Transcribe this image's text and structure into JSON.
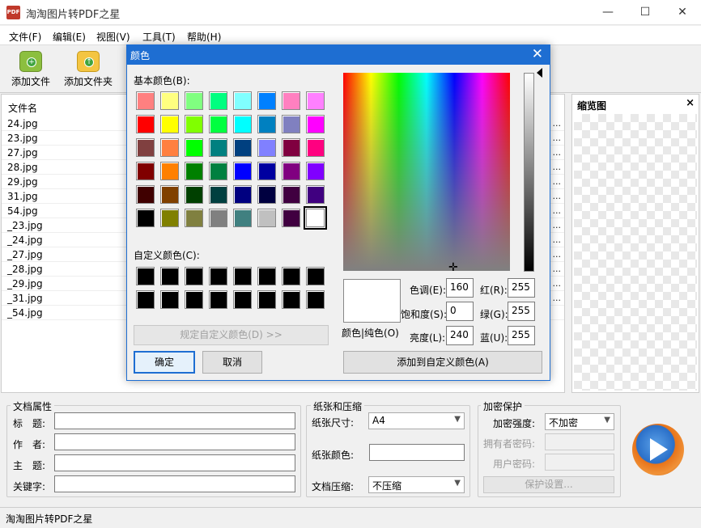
{
  "window": {
    "title": "淘淘图片转PDF之星",
    "icon_text": "PDF",
    "minimize": "—",
    "maximize": "☐",
    "close": "✕"
  },
  "menu": [
    "文件(F)",
    "编辑(E)",
    "视图(V)",
    "工具(T)",
    "帮助(H)"
  ],
  "toolbar": {
    "add_file": "添加文件",
    "add_folder": "添加文件夹",
    "add_glyph": "+",
    "folder_glyph": "↑"
  },
  "file_list": {
    "header": "文件名",
    "ellipsis": "...",
    "files": [
      "24.jpg",
      "23.jpg",
      "27.jpg",
      "28.jpg",
      "29.jpg",
      "31.jpg",
      "54.jpg",
      "_23.jpg",
      "_24.jpg",
      "_27.jpg",
      "_28.jpg",
      "_29.jpg",
      "_31.jpg",
      "_54.jpg"
    ]
  },
  "thumbnail": {
    "title": "缩览图",
    "close": "×"
  },
  "doc_props": {
    "title": "文档属性",
    "fields": [
      "标　题:",
      "作　者:",
      "主　题:",
      "关键字:"
    ]
  },
  "paper": {
    "title": "纸张和压缩",
    "size_label": "纸张尺寸:",
    "size_value": "A4",
    "color_label": "纸张颜色:",
    "compress_label": "文档压缩:",
    "compress_value": "不压缩"
  },
  "encrypt": {
    "title": "加密保护",
    "strength_label": "加密强度:",
    "strength_value": "不加密",
    "owner_label": "拥有者密码:",
    "user_label": "用户密码:",
    "settings_button": "保护设置..."
  },
  "status": {
    "text": "淘淘图片转PDF之星"
  },
  "dialog": {
    "title": "颜色",
    "close": "✕",
    "basic_label": "基本颜色(B):",
    "custom_label": "自定义颜色(C):",
    "define_button": "规定自定义颜色(D) >>",
    "ok": "确定",
    "cancel": "取消",
    "preview_label": "颜色|纯色(O)",
    "hue_label": "色调(E):",
    "hue": "160",
    "sat_label": "饱和度(S):",
    "sat": "0",
    "lum_label": "亮度(L):",
    "lum": "240",
    "red_label": "红(R):",
    "red": "255",
    "green_label": "绿(G):",
    "green": "255",
    "blue_label": "蓝(U):",
    "blue": "255",
    "add_custom": "添加到自定义颜色(A)",
    "basic_colors": [
      "#ff8080",
      "#ffff80",
      "#80ff80",
      "#00ff80",
      "#80ffff",
      "#0080ff",
      "#ff80c0",
      "#ff80ff",
      "#ff0000",
      "#ffff00",
      "#80ff00",
      "#00ff40",
      "#00ffff",
      "#0080c0",
      "#8080c0",
      "#ff00ff",
      "#804040",
      "#ff8040",
      "#00ff00",
      "#008080",
      "#004080",
      "#8080ff",
      "#800040",
      "#ff0080",
      "#800000",
      "#ff8000",
      "#008000",
      "#008040",
      "#0000ff",
      "#0000a0",
      "#800080",
      "#8000ff",
      "#400000",
      "#804000",
      "#004000",
      "#004040",
      "#000080",
      "#000040",
      "#400040",
      "#400080",
      "#000000",
      "#808000",
      "#808040",
      "#808080",
      "#408080",
      "#c0c0c0",
      "#400040",
      "#ffffff"
    ],
    "custom_colors": [
      "#000000",
      "#000000",
      "#000000",
      "#000000",
      "#000000",
      "#000000",
      "#000000",
      "#000000",
      "#000000",
      "#000000",
      "#000000",
      "#000000",
      "#000000",
      "#000000",
      "#000000",
      "#000000"
    ]
  }
}
